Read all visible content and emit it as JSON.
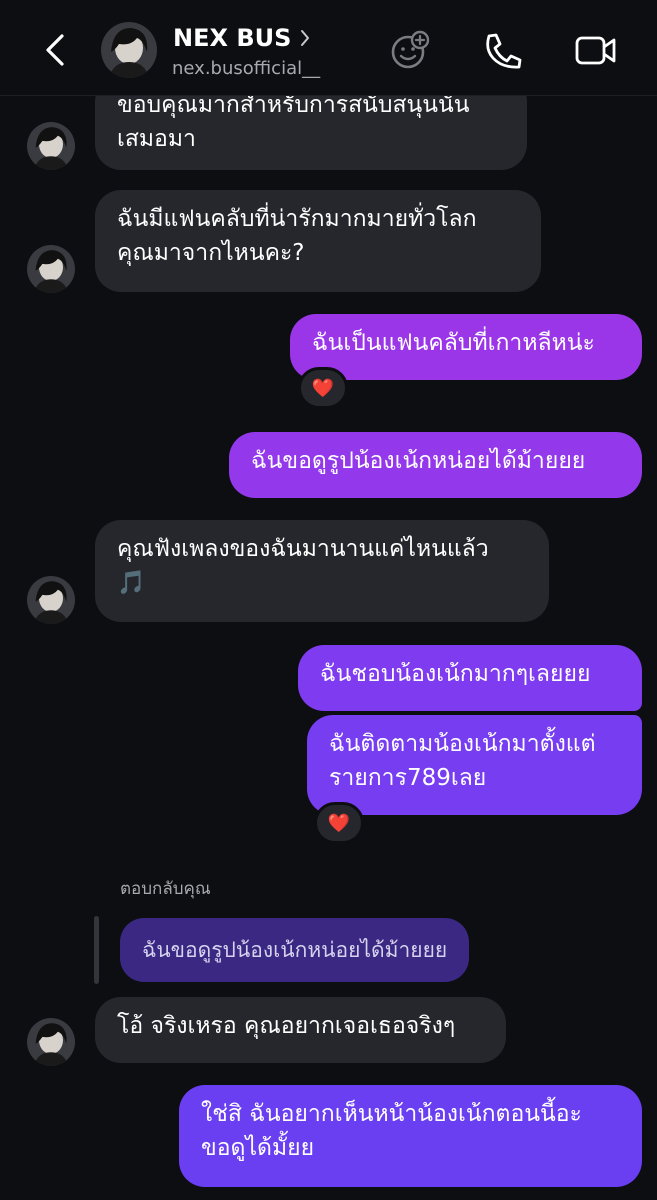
{
  "header": {
    "name": "NEX BUS",
    "handle": "nex.busofficial__"
  },
  "messages": {
    "m1": "ขอบคุณมากสำหรับการสนับสนุนนั้น\nเสมอมา",
    "m2": "ฉันมีแฟนคลับที่น่ารักมากมายทั่วโลก\nคุณมาจากไหนคะ?",
    "m3": "ฉันเป็นแฟนคลับที่เกาหลีหน่ะ",
    "m4": "ฉันขอดูรูปน้องเน้กหน่อยได้ม้ายยย",
    "m5": "คุณฟังเพลงของฉันมานานแค่ไหนแล้ว\n🎵",
    "m6": "ฉันชอบน้องเน้กมากๆเลยยย",
    "m7": "ฉันติดตามน้องเน้กมาตั้งแต่\nรายการ789เลย",
    "reply_label": "ตอบกลับคุณ",
    "quoted": "ฉันขอดูรูปน้องเน้กหน่อยได้ม้ายยย",
    "m8": "โอ้ จริงเหรอ คุณอยากเจอเธอจริงๆ",
    "m9": "ใช่สิ ฉันอยากเห็นหน้าน้องเน้กตอนนี้อะ\nขอดูได้มั้ยย"
  },
  "reactions": {
    "r1": "❤️",
    "r2": "❤️"
  },
  "colors": {
    "background": "#0d0e12",
    "incoming": "#26272c",
    "outgoing_purple": "#9a37e6",
    "outgoing_violet": "#6f3cf2",
    "quoted_bubble": "#3a2883"
  },
  "icons": [
    "back-arrow-icon",
    "chevron-right-icon",
    "sticker-add-icon",
    "phone-icon",
    "video-camera-icon"
  ]
}
